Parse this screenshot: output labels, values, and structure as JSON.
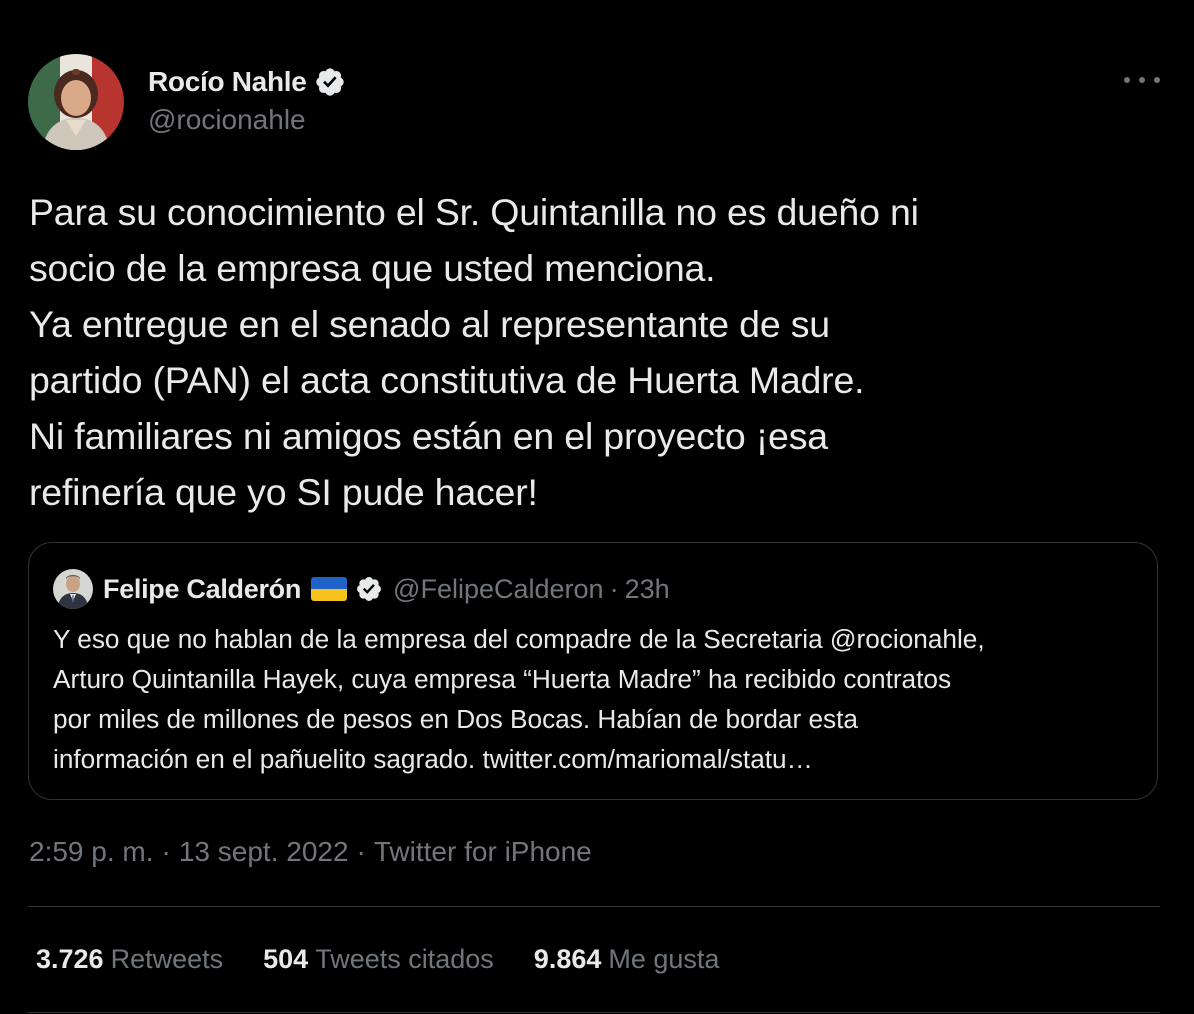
{
  "author": {
    "display_name": "Rocío Nahle",
    "handle": "@rocionahle",
    "verified": true,
    "avatar": "profile-photo"
  },
  "more_icon": "more-horizontal-icon",
  "tweet_text": "Para su conocimiento el Sr. Quintanilla no es dueño ni\nsocio de la empresa que usted menciona.\nYa entregue en el senado al representante de su\npartido (PAN) el acta constitutiva de Huerta Madre.\nNi familiares ni amigos están en el proyecto ¡esa\nrefinería que yo SI pude hacer!",
  "quoted_tweet": {
    "display_name": "Felipe Calderón",
    "flag": "ukraine-flag",
    "verified": true,
    "handle": "@FelipeCalderon",
    "separator": "·",
    "time": "23h",
    "text": "Y eso que no hablan de la empresa del compadre de la Secretaria @rocionahle,\nArturo Quintanilla Hayek, cuya empresa “Huerta Madre” ha recibido contratos\npor miles de millones de pesos en Dos Bocas. Habían de bordar esta\ninformación en el pañuelito sagrado. twitter.com/mariomal/statu…"
  },
  "meta": {
    "time": "2:59 p. m.",
    "separator": "·",
    "date": "13 sept. 2022",
    "source": "Twitter for iPhone"
  },
  "stats": {
    "retweets_count": "3.726",
    "retweets_label": "Retweets",
    "quotes_count": "504",
    "quotes_label": "Tweets citados",
    "likes_count": "9.864",
    "likes_label": "Me gusta"
  },
  "colors": {
    "background": "#000000",
    "text_primary": "#e7e9ea",
    "text_secondary": "#71767b",
    "border": "#2f3336"
  }
}
